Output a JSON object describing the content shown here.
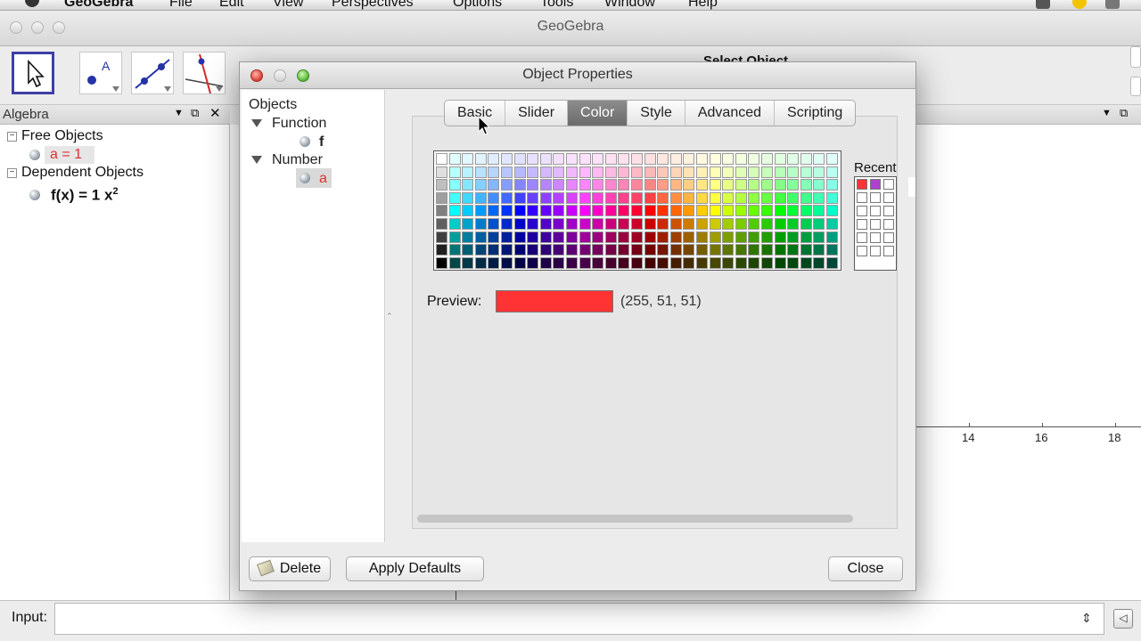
{
  "menubar": {
    "app_name": "GeoGebra",
    "items": [
      "File",
      "Edit",
      "View",
      "Perspectives",
      "Options",
      "Tools",
      "Window",
      "Help"
    ]
  },
  "window": {
    "title": "GeoGebra"
  },
  "toolbar": {
    "hint_title": "Select Object"
  },
  "algebra": {
    "header": "Algebra",
    "free_objects_label": "Free Objects",
    "free_item": "a = 1",
    "dependent_objects_label": "Dependent Objects",
    "dependent_item": "f(x) = 1 x",
    "dependent_item_exp": "2"
  },
  "graphics": {
    "tick_labels": [
      "14",
      "16",
      "18"
    ]
  },
  "input": {
    "label": "Input:",
    "value": ""
  },
  "dialog": {
    "title": "Object Properties",
    "objects_label": "Objects",
    "tree": {
      "function_label": "Function",
      "function_item": "f",
      "number_label": "Number",
      "number_item": "a"
    },
    "tabs": [
      "Basic",
      "Slider",
      "Color",
      "Style",
      "Advanced",
      "Scripting"
    ],
    "active_tab": "Color",
    "recent_label": "Recent",
    "recent_colors": [
      "#ff3333",
      "#b040d0"
    ],
    "preview_label": "Preview:",
    "preview_color": "#ff3333",
    "preview_rgb": "(255, 51, 51)",
    "delete_label": "Delete",
    "apply_defaults_label": "Apply Defaults",
    "close_label": "Close"
  }
}
